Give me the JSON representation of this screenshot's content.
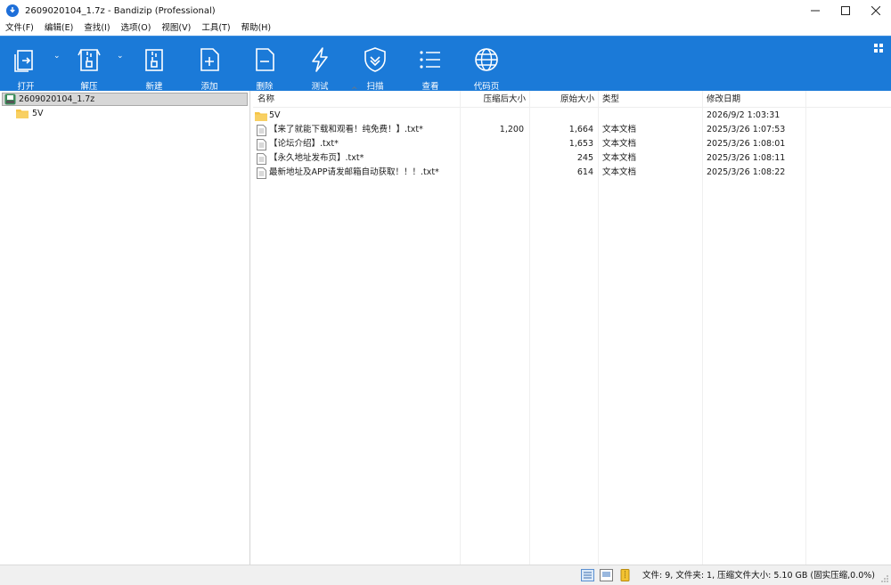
{
  "window": {
    "title": "2609020104_1.7z - Bandizip (Professional)"
  },
  "menu": [
    "文件(F)",
    "编辑(E)",
    "查找(I)",
    "选项(O)",
    "视图(V)",
    "工具(T)",
    "帮助(H)"
  ],
  "toolbar": {
    "open": "打开",
    "extract": "解压",
    "new": "新建",
    "add": "添加",
    "delete": "删除",
    "test": "测试",
    "scan": "扫描",
    "view": "查看",
    "codepage": "代码页"
  },
  "tree": {
    "root": "2609020104_1.7z",
    "child": "5V"
  },
  "columns": {
    "name": "名称",
    "packed": "压缩后大小",
    "size": "原始大小",
    "type": "类型",
    "modified": "修改日期"
  },
  "files": [
    {
      "name": "5V",
      "packed": "",
      "size": "",
      "type": "",
      "modified": "2026/9/2 1:03:31",
      "icon": "folder-icon"
    },
    {
      "name": "【来了就能下载和观看！纯免费！】.txt*",
      "packed": "1,200",
      "size": "1,664",
      "type": "文本文档",
      "modified": "2025/3/26 1:07:53",
      "icon": "text-file-icon"
    },
    {
      "name": "【论坛介绍】.txt*",
      "packed": "",
      "size": "1,653",
      "type": "文本文档",
      "modified": "2025/3/26 1:08:01",
      "icon": "text-file-icon"
    },
    {
      "name": "【永久地址发布页】.txt*",
      "packed": "",
      "size": "245",
      "type": "文本文档",
      "modified": "2025/3/26 1:08:11",
      "icon": "text-file-icon"
    },
    {
      "name": "最新地址及APP请发邮箱自动获取！！！.txt*",
      "packed": "",
      "size": "614",
      "type": "文本文档",
      "modified": "2025/3/26 1:08:22",
      "icon": "text-file-icon"
    }
  ],
  "status": {
    "text": "文件: 9, 文件夹: 1, 压缩文件大小: 5.10 GB (固实压缩,0.0%)"
  },
  "colors": {
    "toolbar": "#1b7ad8",
    "tree_selected": "#d7d7d7",
    "folder": "#f6c446"
  }
}
